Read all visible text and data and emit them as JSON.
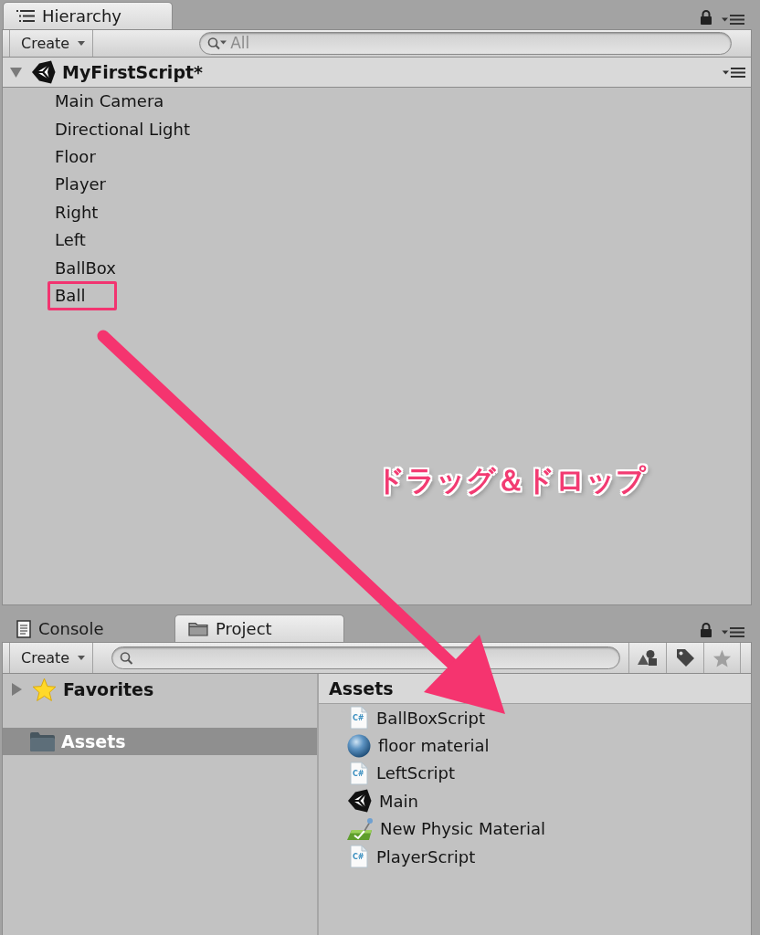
{
  "hierarchy": {
    "tabs": [
      {
        "label": "Hierarchy",
        "selected": true
      }
    ],
    "create_button": "Create",
    "search": {
      "placeholder": "All"
    },
    "scene": {
      "name": "MyFirstScript*",
      "expanded": true
    },
    "items": [
      {
        "label": "Main Camera",
        "marked": false
      },
      {
        "label": "Directional Light",
        "marked": false
      },
      {
        "label": "Floor",
        "marked": false
      },
      {
        "label": "Player",
        "marked": false
      },
      {
        "label": "Right",
        "marked": false
      },
      {
        "label": "Left",
        "marked": false
      },
      {
        "label": "BallBox",
        "marked": false
      },
      {
        "label": "Ball",
        "marked": true
      }
    ]
  },
  "annotation": {
    "text": "ドラッグ＆ドロップ"
  },
  "project_panel": {
    "tabs": [
      {
        "label": "Console",
        "kind": "console",
        "selected": false
      },
      {
        "label": "Project",
        "kind": "project",
        "selected": true
      }
    ],
    "create_button": "Create",
    "favorites": {
      "label": "Favorites",
      "expanded": false
    },
    "folders": [
      {
        "label": "Assets",
        "selected": true
      }
    ],
    "assets_header": "Assets",
    "assets": [
      {
        "label": "BallBoxScript",
        "kind": "script",
        "icon_text": "C#"
      },
      {
        "label": "floor material",
        "kind": "material"
      },
      {
        "label": "LeftScript",
        "kind": "script",
        "icon_text": "C#"
      },
      {
        "label": "Main",
        "kind": "scene"
      },
      {
        "label": "New Physic Material",
        "kind": "physic_material"
      },
      {
        "label": "PlayerScript",
        "kind": "script",
        "icon_text": "C#"
      }
    ]
  }
}
